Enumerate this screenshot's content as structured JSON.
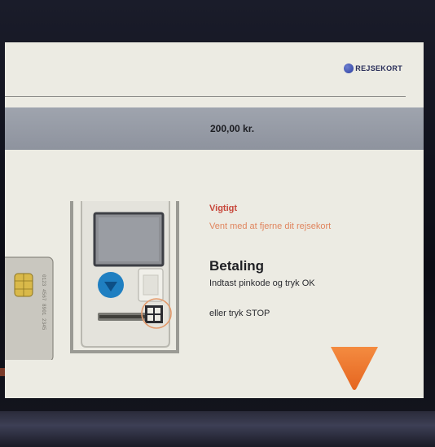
{
  "brand": {
    "logo_text": "REJSEKORT"
  },
  "amount": {
    "text": "200,00 kr."
  },
  "notice": {
    "title": "Vigtigt",
    "message": "Vent med at fjerne dit rejsekort"
  },
  "payment": {
    "title": "Betaling",
    "instruction": "Indtast pinkode og tryk OK",
    "alternative": "eller tryk STOP"
  },
  "card": {
    "chip_text": "0123 4567 8901 2345"
  },
  "colors": {
    "accent_red": "#c7463a",
    "warning_orange": "#e0855e",
    "ok_orange": "#ef7b33",
    "bar_gray": "#9fa4ae",
    "terminal_blue": "#1f7fc1"
  },
  "icons": {
    "ok_button": "orange-triangle-icon",
    "terminal": "card-terminal-icon",
    "card": "payment-card-icon"
  }
}
